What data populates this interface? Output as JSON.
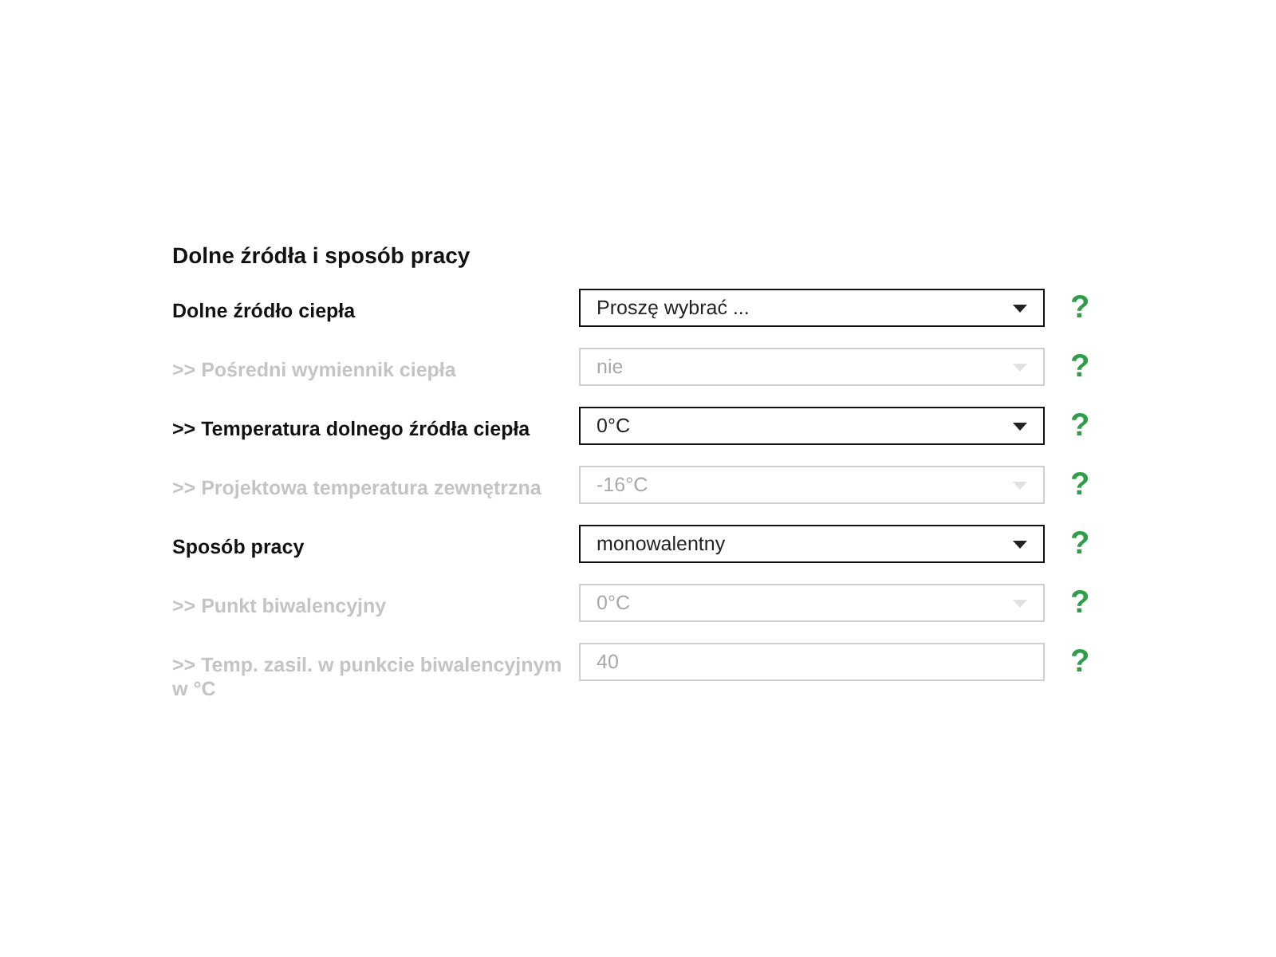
{
  "section": {
    "title": "Dolne źródła i sposób pracy"
  },
  "rows": [
    {
      "label": "Dolne źródło ciepła",
      "kind": "select",
      "value": "Proszę wybrać ...",
      "disabled": false,
      "help": "?"
    },
    {
      "label": ">> Pośredni wymiennik ciepła",
      "kind": "select",
      "value": "nie",
      "disabled": true,
      "help": "?"
    },
    {
      "label": ">> Temperatura dolnego źródła ciepła",
      "kind": "select",
      "value": "0°C",
      "disabled": false,
      "help": "?"
    },
    {
      "label": ">> Projektowa temperatura zewnętrzna",
      "kind": "select",
      "value": "-16°C",
      "disabled": true,
      "help": "?"
    },
    {
      "label": "Sposób pracy",
      "kind": "select",
      "value": "monowalentny",
      "disabled": false,
      "help": "?"
    },
    {
      "label": ">> Punkt biwalencyjny",
      "kind": "select",
      "value": "0°C",
      "disabled": true,
      "help": "?"
    },
    {
      "label": ">> Temp. zasil. w punkcie biwalencyjnym w °C",
      "kind": "input",
      "value": "40",
      "disabled": true,
      "help": "?"
    }
  ]
}
